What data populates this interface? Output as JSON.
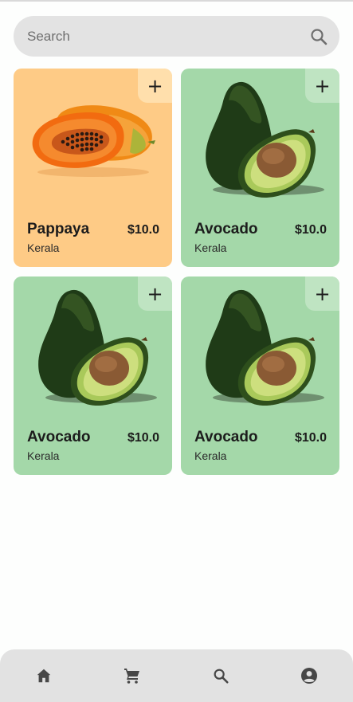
{
  "search": {
    "placeholder": "Search",
    "icon": "search-icon"
  },
  "products": [
    {
      "name": "Pappaya",
      "origin": "Kerala",
      "price": "$10.0",
      "color": "#fecb86",
      "image": "papaya"
    },
    {
      "name": "Avocado",
      "origin": "Kerala",
      "price": "$10.0",
      "color": "#a4d8a9",
      "image": "avocado"
    },
    {
      "name": "Avocado",
      "origin": "Kerala",
      "price": "$10.0",
      "color": "#a4d8a9",
      "image": "avocado"
    },
    {
      "name": "Avocado",
      "origin": "Kerala",
      "price": "$10.0",
      "color": "#a4d8a9",
      "image": "avocado"
    }
  ],
  "add_icon": "plus-icon",
  "nav": {
    "items": [
      "home-icon",
      "cart-icon",
      "search-icon",
      "account-icon"
    ],
    "color": "#474747"
  }
}
